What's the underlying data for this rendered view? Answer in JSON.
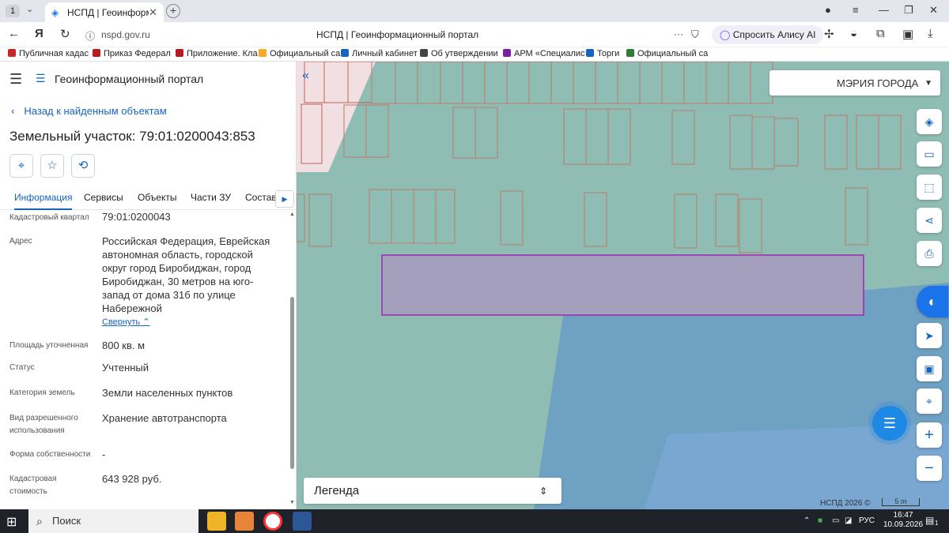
{
  "browser": {
    "tab_number": "1",
    "tab_title": "НСПД | Геоинформац",
    "url": "nspd.gov.ru",
    "page_title": "НСПД | Геоинформационный портал",
    "alice_label": "Спросить Алису AI",
    "bookmarks": [
      {
        "label": "Публичная кадас",
        "color": "#c62828"
      },
      {
        "label": "Приказ Федерал",
        "color": "#b71c1c"
      },
      {
        "label": "Приложение. Кла",
        "color": "#b71c1c"
      },
      {
        "label": "Официальный са",
        "color": "#f9a825"
      },
      {
        "label": "Личный кабинет",
        "color": "#1565c0"
      },
      {
        "label": "Об утверждении",
        "color": "#444444"
      },
      {
        "label": "АРМ «Специалис",
        "color": "#7b1fa2"
      },
      {
        "label": "Торги",
        "color": "#1565c0"
      },
      {
        "label": "Официальный са",
        "color": "#2e7d32"
      }
    ]
  },
  "sidebar": {
    "header_title": "Геоинформационный портал",
    "back_label": "Назад к найденным объектам",
    "parcel_title": "Земельный участок: 79:01:0200043:853",
    "tabs": [
      "Информация",
      "Сервисы",
      "Объекты",
      "Части ЗУ",
      "Состав"
    ],
    "active_tab": "Информация",
    "fields": {
      "quarter": {
        "label": "Кадастровый квартал",
        "value": "79:01:0200043"
      },
      "address": {
        "label": "Адрес",
        "value": "Российская Федерация, Еврейская автономная область, городской округ город Биробиджан, город Биробиджан, 30 метров на юго-запад от дома 31б по улице Набережной"
      },
      "area": {
        "label": "Площадь уточненная",
        "value": "800 кв. м"
      },
      "status": {
        "label": "Статус",
        "value": "Учтенный"
      },
      "category": {
        "label": "Категория земель",
        "value": "Земли населенных пунктов"
      },
      "usage": {
        "label": "Вид разрешенного использования",
        "value": "Хранение автотранспорта"
      },
      "ownership": {
        "label": "Форма собственности",
        "value": "-"
      },
      "cost": {
        "label": "Кадастровая стоимость",
        "value": "643 928 руб."
      }
    },
    "collapse_label": "Свернуть"
  },
  "map": {
    "mayor_label": "МЭРИЯ ГОРОДА",
    "legend_label": "Легенда",
    "credit": "НСПД 2026 ©",
    "scale_label": "5 m",
    "colors": {
      "base": "#8fbdb4",
      "water": "#6a9cc4",
      "selected_stroke": "#9b2bb0",
      "selected_fill": "#a59fbe",
      "parcel_stroke": "#b87a6a"
    }
  },
  "taskbar": {
    "search_placeholder": "Поиск",
    "lang": "РУС",
    "time": "16:47",
    "date": "10.09.2026",
    "notifications": "1"
  }
}
